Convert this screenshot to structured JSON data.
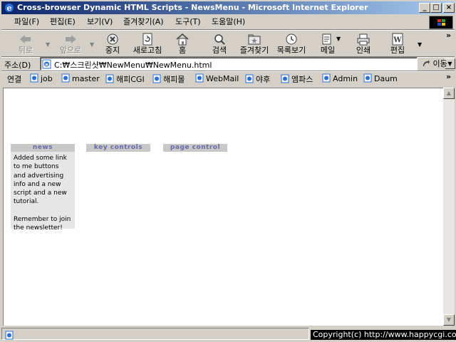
{
  "window": {
    "title": "Cross-browser Dynamic HTML Scripts - NewsMenu - Microsoft Internet Explorer",
    "min_label": "_",
    "max_label": "□",
    "close_label": "×"
  },
  "menu": [
    "파일(F)",
    "편집(E)",
    "보기(V)",
    "즐겨찾기(A)",
    "도구(T)",
    "도움말(H)"
  ],
  "toolbar": {
    "back": "뒤로",
    "forward": "앞으로",
    "stop": "중지",
    "refresh": "새로고침",
    "home": "홈",
    "search": "검색",
    "favorites": "즐겨찾기",
    "history": "목록보기",
    "mail": "메일",
    "print": "인쇄",
    "edit": "편집",
    "chevron": "»"
  },
  "address": {
    "label": "주소(D)",
    "value": "C:₩스크린샷₩NewMenu₩NewMenu.html",
    "go": "이동",
    "drop": "▼"
  },
  "links": {
    "label": "연결",
    "items": [
      "job",
      "master",
      "해피CGI",
      "해피몰",
      "WebMail",
      "야후",
      "엠파스",
      "Admin",
      "Daum"
    ],
    "chevron": "»"
  },
  "page": {
    "nav": {
      "news": "news",
      "key_controls": "key controls",
      "page_control": "page control"
    },
    "news_text_1": "Added some link to me buttons and advertising info and a new script and a new tutorial.",
    "news_text_2": "Remember to join the newsletter!"
  },
  "scrollbar": {
    "up": "▲",
    "down": "▼"
  },
  "status": {
    "copyright": "Copyright(c) http://www.happycgi.com"
  },
  "colors": {
    "titlebar_start": "#0a246a",
    "titlebar_end": "#a6caf0",
    "nav_header_bg": "#c8c8c8",
    "nav_header_text": "#6a6aaa",
    "news_box_bg": "#e6e6e6"
  }
}
